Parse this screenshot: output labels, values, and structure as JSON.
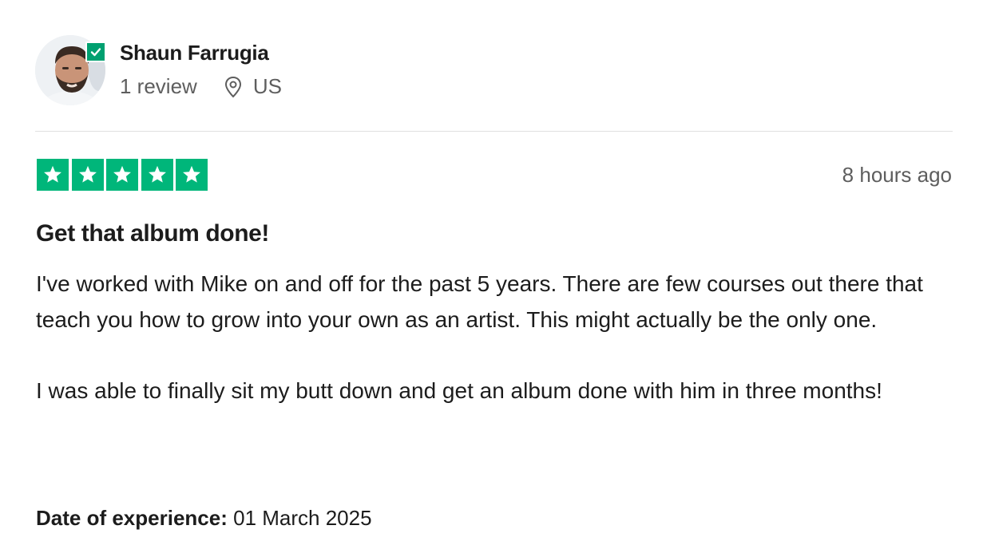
{
  "reviewer": {
    "name": "Shaun Farrugia",
    "review_count": "1 review",
    "location": "US",
    "verified": true
  },
  "review": {
    "rating": 5,
    "max_rating": 5,
    "time_ago": "8 hours ago",
    "title": "Get that album done!",
    "paragraphs": [
      "I've worked with Mike on and off for the past 5 years. There are few courses out there that teach you how to grow into your own as an artist. This might actually be the only one.",
      "I was able to finally sit my butt down and get an album done with him in three months!"
    ],
    "experience_label": "Date of experience:",
    "experience_date": "01 March 2025"
  },
  "icons": {
    "avatar": "avatar",
    "verified": "check-badge-icon",
    "location": "map-pin-icon",
    "star": "star-icon"
  },
  "colors": {
    "star_green": "#00b67a",
    "verified_green": "#00a070",
    "muted_text": "#5e5e5e",
    "divider": "#e0e0e0"
  }
}
